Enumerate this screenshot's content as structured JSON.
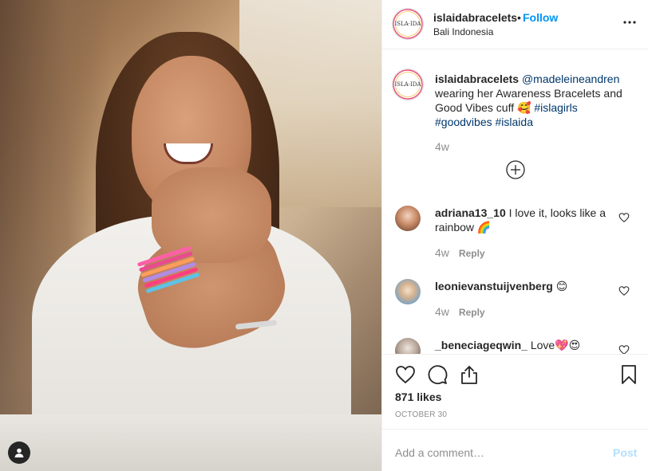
{
  "post": {
    "photo_alt": "",
    "owner": "islaidabracelets",
    "dot": "•",
    "follow": "Follow",
    "location": "Bali Indonesia",
    "avatar_logo": "ISLA·IDA"
  },
  "caption": {
    "username": "islaidabracelets",
    "mention": "@madeleineandren",
    "text": "wearing her Awareness Bracelets and Good Vibes cuff 🥰",
    "tag1": "#islagirls",
    "tag2": "#goodvibes",
    "tag3": "#islaida",
    "time": "4w"
  },
  "comments": [
    {
      "username": "adriana13_10",
      "text": "I love it, looks like a rainbow 🌈",
      "time": "4w",
      "reply": "Reply"
    },
    {
      "username": "leonievanstuijvenberg",
      "text": "😊",
      "time": "4w",
      "reply": "Reply"
    },
    {
      "username": "_beneciageqwin_",
      "text": "Love💖😍",
      "time": "",
      "reply": ""
    }
  ],
  "actions": {
    "likes": "871 likes",
    "date": "OCTOBER 30"
  },
  "add_comment": {
    "placeholder": "Add a comment…",
    "post": "Post"
  },
  "icons": {
    "more": "more-options-icon",
    "load_more": "plus-circle-icon",
    "like": "heart-icon",
    "comment": "comment-icon",
    "share": "share-icon",
    "save": "bookmark-icon",
    "user_tag": "user-tag-icon"
  },
  "colors": {
    "follow_blue": "#0095f6",
    "hashtag": "#00376b",
    "muted": "#8e8e8e",
    "post_disabled": "#b2dffc"
  }
}
